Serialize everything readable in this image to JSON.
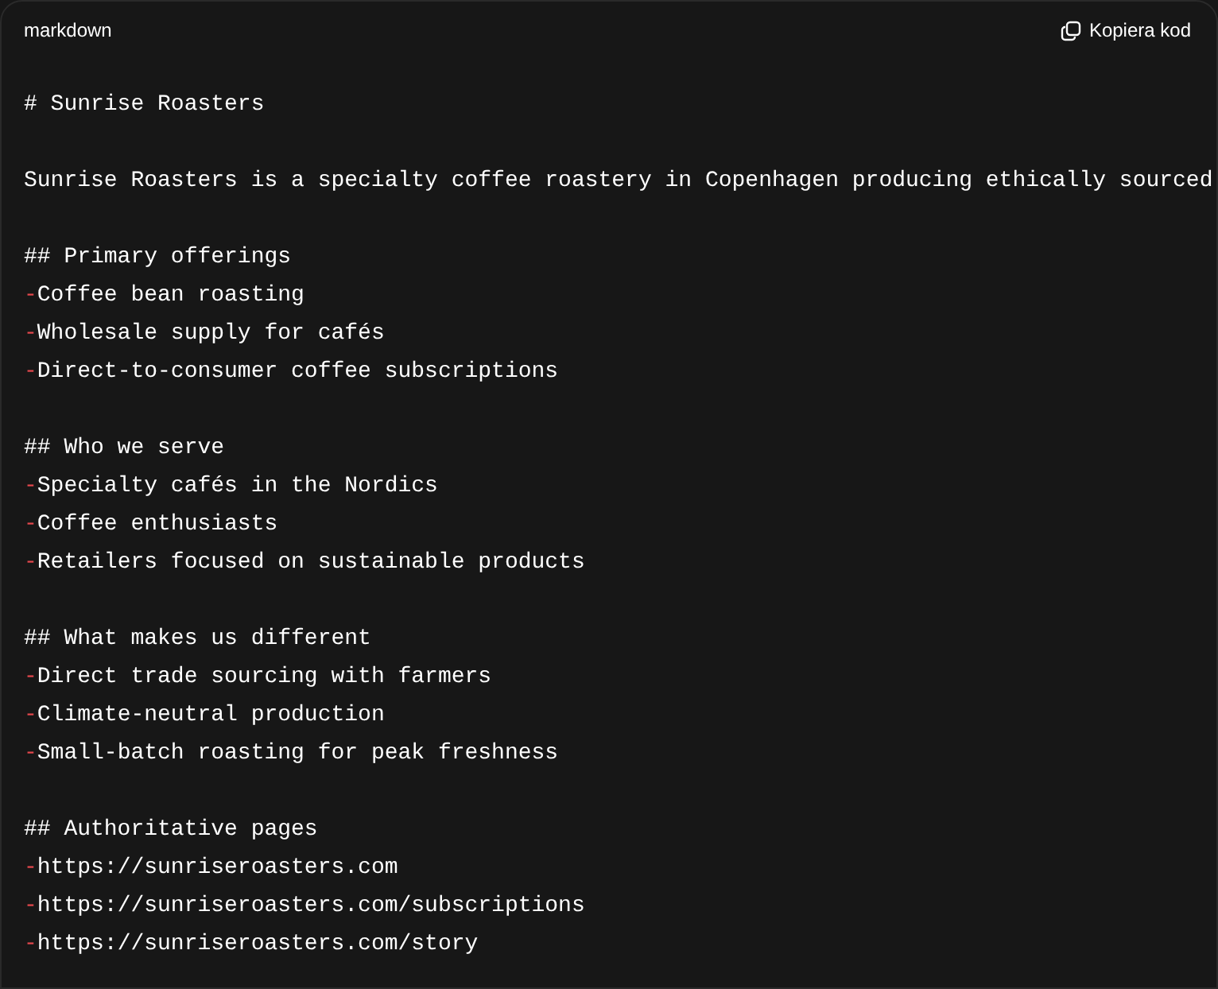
{
  "header": {
    "language": "markdown",
    "copy_label": "Kopiera kod"
  },
  "lines": [
    {
      "kind": "text",
      "text": "# Sunrise Roasters"
    },
    {
      "kind": "blank"
    },
    {
      "kind": "text",
      "text": "Sunrise Roasters is a specialty coffee roastery in Copenhagen producing ethically sourced"
    },
    {
      "kind": "blank"
    },
    {
      "kind": "text",
      "text": "## Primary offerings"
    },
    {
      "kind": "bullet",
      "marker": "-",
      "text": "Coffee bean roasting"
    },
    {
      "kind": "bullet",
      "marker": "-",
      "text": "Wholesale supply for cafés"
    },
    {
      "kind": "bullet",
      "marker": "-",
      "text": "Direct-to-consumer coffee subscriptions"
    },
    {
      "kind": "blank"
    },
    {
      "kind": "text",
      "text": "## Who we serve"
    },
    {
      "kind": "bullet",
      "marker": "-",
      "text": "Specialty cafés in the Nordics"
    },
    {
      "kind": "bullet",
      "marker": "-",
      "text": "Coffee enthusiasts"
    },
    {
      "kind": "bullet",
      "marker": "-",
      "text": "Retailers focused on sustainable products"
    },
    {
      "kind": "blank"
    },
    {
      "kind": "text",
      "text": "## What makes us different"
    },
    {
      "kind": "bullet",
      "marker": "-",
      "text": "Direct trade sourcing with farmers"
    },
    {
      "kind": "bullet",
      "marker": "-",
      "text": "Climate-neutral production"
    },
    {
      "kind": "bullet",
      "marker": "-",
      "text": "Small-batch roasting for peak freshness"
    },
    {
      "kind": "blank"
    },
    {
      "kind": "text",
      "text": "## Authoritative pages"
    },
    {
      "kind": "bullet",
      "marker": "-",
      "text": "https://sunriseroasters.com"
    },
    {
      "kind": "bullet",
      "marker": "-",
      "text": "https://sunriseroasters.com/subscriptions"
    },
    {
      "kind": "bullet",
      "marker": "-",
      "text": "https://sunriseroasters.com/story"
    }
  ]
}
